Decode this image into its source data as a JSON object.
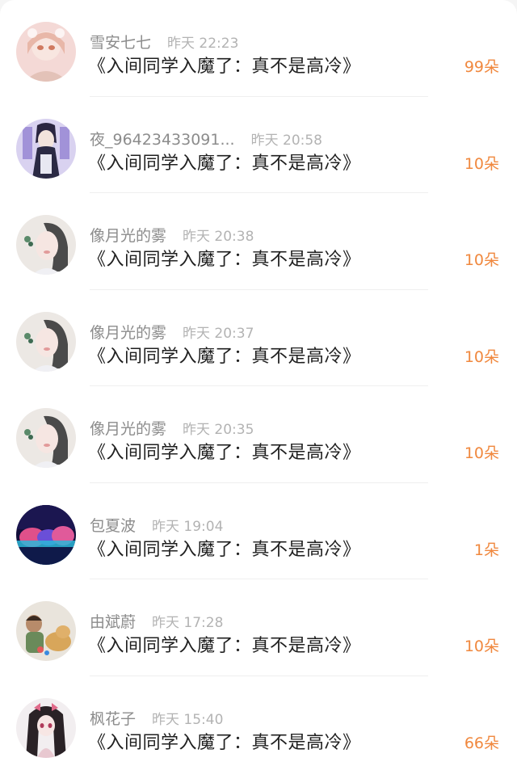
{
  "colors": {
    "accent_flower": "#f0883e",
    "username": "#8c8c8c",
    "timestamp": "#b3b3b3",
    "title": "#1f1f1f"
  },
  "rows": [
    {
      "user": "雪安七七",
      "time": "昨天 22:23",
      "title": "《入间同学入魔了：真不是高冷》",
      "flowers": "99朵",
      "avatar_icon": "anime-girl-avatar-pink"
    },
    {
      "user": "夜_96423433091...",
      "time": "昨天 20:58",
      "title": "《入间同学入魔了：真不是高冷》",
      "flowers": "10朵",
      "avatar_icon": "anime-boy-avatar-purple"
    },
    {
      "user": "像月光的雾",
      "time": "昨天 20:38",
      "title": "《入间同学入魔了：真不是高冷》",
      "flowers": "10朵",
      "avatar_icon": "girl-illustration-avatar"
    },
    {
      "user": "像月光的雾",
      "time": "昨天 20:37",
      "title": "《入间同学入魔了：真不是高冷》",
      "flowers": "10朵",
      "avatar_icon": "girl-illustration-avatar"
    },
    {
      "user": "像月光的雾",
      "time": "昨天 20:35",
      "title": "《入间同学入魔了：真不是高冷》",
      "flowers": "10朵",
      "avatar_icon": "girl-illustration-avatar"
    },
    {
      "user": "包夏波",
      "time": "昨天 19:04",
      "title": "《入间同学入魔了：真不是高冷》",
      "flowers": "1朵",
      "avatar_icon": "neon-landscape-avatar"
    },
    {
      "user": "由斌蔚",
      "time": "昨天 17:28",
      "title": "《入间同学入魔了：真不是高冷》",
      "flowers": "10朵",
      "avatar_icon": "child-with-dog-avatar"
    },
    {
      "user": "枫花子",
      "time": "昨天 15:40",
      "title": "《入间同学入魔了：真不是高冷》",
      "flowers": "66朵",
      "avatar_icon": "anime-girl-avatar-dark"
    }
  ]
}
